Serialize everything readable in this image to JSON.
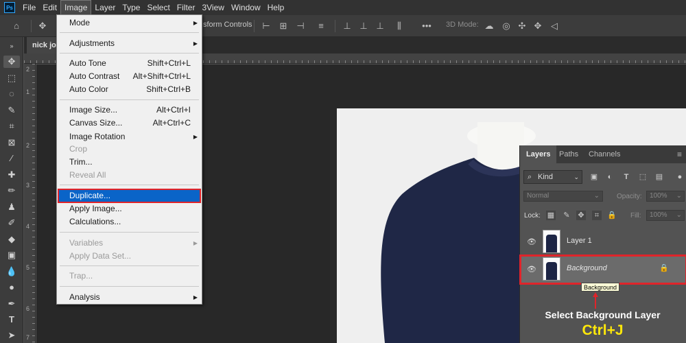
{
  "app": {
    "logo": "Ps"
  },
  "menubar": {
    "items": [
      "File",
      "Edit",
      "Image",
      "Layer",
      "Type",
      "Select",
      "Filter",
      "3View",
      "Window",
      "Help"
    ]
  },
  "optionsbar": {
    "transform_controls": "sform Controls",
    "mode_3d": "3D Mode:"
  },
  "document": {
    "tab": "nick joi"
  },
  "ruler": {
    "vertical": [
      "2",
      "1",
      "2",
      "3",
      "4",
      "5",
      "6",
      "7"
    ]
  },
  "image_menu": {
    "mode": "Mode",
    "adjustments": "Adjustments",
    "auto_tone": {
      "label": "Auto Tone",
      "shortcut": "Shift+Ctrl+L"
    },
    "auto_contrast": {
      "label": "Auto Contrast",
      "shortcut": "Alt+Shift+Ctrl+L"
    },
    "auto_color": {
      "label": "Auto Color",
      "shortcut": "Shift+Ctrl+B"
    },
    "image_size": {
      "label": "Image Size...",
      "shortcut": "Alt+Ctrl+I"
    },
    "canvas_size": {
      "label": "Canvas Size...",
      "shortcut": "Alt+Ctrl+C"
    },
    "image_rotation": "Image Rotation",
    "crop": "Crop",
    "trim": "Trim...",
    "reveal_all": "Reveal All",
    "duplicate": "Duplicate...",
    "apply_image": "Apply Image...",
    "calculations": "Calculations...",
    "variables": "Variables",
    "apply_data_set": "Apply Data Set...",
    "trap": "Trap...",
    "analysis": "Analysis"
  },
  "layers_panel": {
    "tabs": [
      "Layers",
      "Paths",
      "Channels"
    ],
    "kind": "Kind",
    "blend_mode": "Normal",
    "opacity_label": "Opacity:",
    "opacity_value": "100%",
    "lock_label": "Lock:",
    "fill_label": "Fill:",
    "fill_value": "100%",
    "layers": [
      "Layer 1",
      "Background"
    ],
    "tooltip": "Background"
  },
  "annotation": {
    "caption": "Select Background Layer",
    "shortcut": "Ctrl+J"
  },
  "colors": {
    "highlight_red": "#e0242a",
    "selection_blue": "#0a64c8",
    "caption_yellow": "#ffe80a"
  }
}
